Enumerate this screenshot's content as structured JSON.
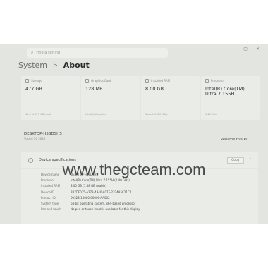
{
  "search": {
    "icon": "search-icon",
    "placeholder": "Find a setting"
  },
  "window_controls": [
    "—",
    "▢",
    "✕"
  ],
  "breadcrumb": {
    "parent": "System",
    "separator": ">",
    "current": "About"
  },
  "cards": [
    {
      "icon": "storage-icon",
      "label": "Storage",
      "value": "477 GB",
      "sub": "48.0 of 477 GB used"
    },
    {
      "icon": "graphics-icon",
      "label": "Graphics Card",
      "value": "128 MB",
      "sub": "Intel(R) Graphics"
    },
    {
      "icon": "ram-icon",
      "label": "Installed RAM",
      "value": "8.00 GB",
      "sub": "Speed: 5600 MT/s"
    },
    {
      "icon": "processor-icon",
      "label": "Processor",
      "value": "Intel(R) Core(TM) Ultra 7 155H",
      "sub": "1.40 GHz"
    }
  ],
  "device": {
    "name": "DESKTOP-H58DSHS",
    "model": "Vostro 16 5640",
    "rename_label": "Rename this PC"
  },
  "spec": {
    "icon": "info-icon",
    "label": "Device specifications",
    "copy_label": "Copy",
    "chevron": "˄",
    "rows": [
      {
        "k": "Device name",
        "v": "DESKTOP-H58DSHS"
      },
      {
        "k": "Processor",
        "v": "Intel(R) Core(TM) Ultra 7 155H (1.40 GHz)"
      },
      {
        "k": "Installed RAM",
        "v": "8.00 GB (7.48 GB usable)"
      },
      {
        "k": "Device ID",
        "v": "2B7DF035-A273-4B40-A07E-2324A5C21C4"
      },
      {
        "k": "Product ID",
        "v": "00328-10000-00000-AA002"
      },
      {
        "k": "System type",
        "v": "64-bit operating system, x64-based processor"
      },
      {
        "k": "Pen and touch",
        "v": "No pen or touch input is available for this display"
      }
    ]
  },
  "watermark": "www.thegcteam.com"
}
